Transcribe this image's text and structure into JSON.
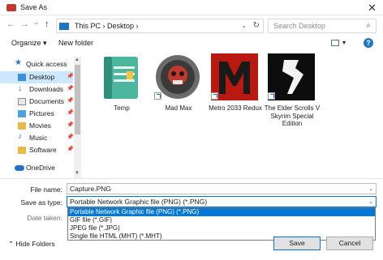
{
  "window": {
    "title": "Save As",
    "close_glyph": "✕"
  },
  "nav": {
    "back_glyph": "←",
    "forward_glyph": "→",
    "recent_glyph": "⌄",
    "up_glyph": "↑",
    "breadcrumb": "This PC  ›  Desktop  ›",
    "dropdown_glyph": "⌄",
    "refresh_glyph": "↻",
    "search_placeholder": "Search Desktop",
    "search_glyph": "⌕"
  },
  "toolbar": {
    "organize": "Organize ▾",
    "new_folder": "New folder",
    "view_dd": "▾",
    "help": "?"
  },
  "sidebar": {
    "items": [
      {
        "label": "Quick access",
        "pin": ""
      },
      {
        "label": "Desktop",
        "pin": "📌"
      },
      {
        "label": "Downloads",
        "pin": "📌"
      },
      {
        "label": "Documents",
        "pin": "📌"
      },
      {
        "label": "Pictures",
        "pin": "📌"
      },
      {
        "label": "Movies",
        "pin": "📌"
      },
      {
        "label": "Music",
        "pin": "📌"
      },
      {
        "label": "Software",
        "pin": "📌"
      },
      {
        "label": "OneDrive",
        "pin": ""
      }
    ],
    "scroll_up": "▲",
    "scroll_down": "▼"
  },
  "files": [
    {
      "name": "Temp"
    },
    {
      "name": "Mad Max"
    },
    {
      "name": "Metro 2033 Redux"
    },
    {
      "name": "The Elder Scrolls V Skyrim Special Edition"
    }
  ],
  "form": {
    "file_name_label": "File name:",
    "file_name_value": "Capture.PNG",
    "save_type_label": "Save as type:",
    "save_type_value": "Portable Network Graphic file (PNG) (*.PNG)",
    "date_label": "Date taken:",
    "dd_glyph": "⌄",
    "options": [
      "Portable Network Graphic file (PNG) (*.PNG)",
      "GIF file (*.GIF)",
      "JPEG file (*.JPG)",
      "Single file HTML (MHT) (*.MHT)"
    ]
  },
  "footer": {
    "hide_folders": "⌃  Hide Folders",
    "save": "Save",
    "cancel": "Cancel"
  },
  "colors": {
    "accent": "#0078d7",
    "selected_bg": "#cce8ff"
  }
}
